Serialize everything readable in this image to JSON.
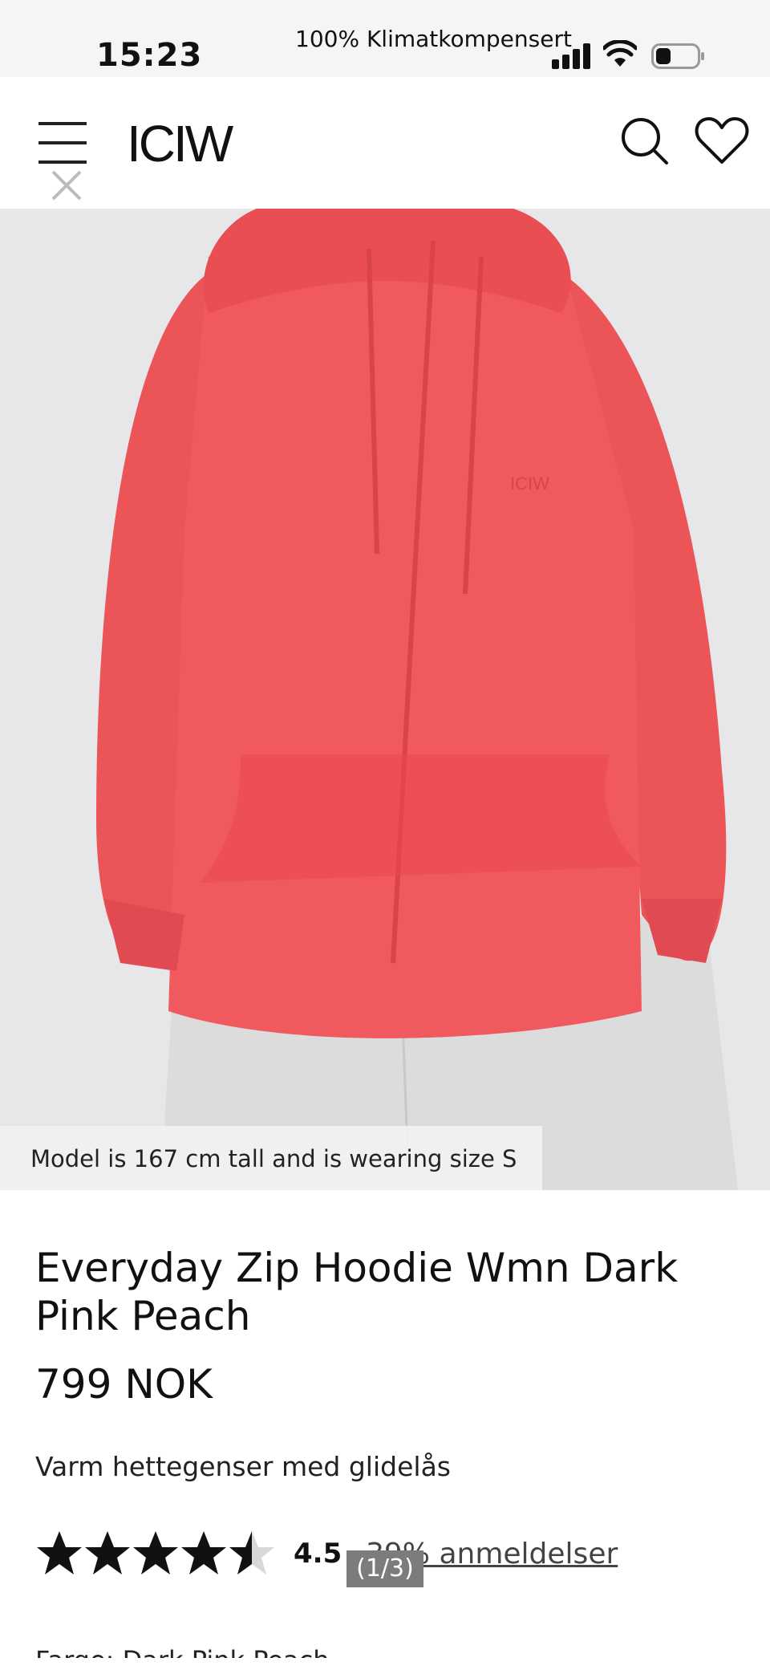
{
  "status_bar": {
    "time": "15:23",
    "carrier": "100% Klimatkompensert"
  },
  "header": {
    "logo": "ICIW",
    "icons": [
      "menu-icon",
      "close-icon",
      "search-icon",
      "heart-icon"
    ]
  },
  "hero": {
    "caption": "Model is 167 cm tall and is wearing size S",
    "image_counter": "(1/3)",
    "colors": {
      "hoodie": "#f05a5e",
      "background": "#e7e7e9",
      "pants": "#dcdcdc"
    }
  },
  "product": {
    "title": "Everyday Zip Hoodie Wmn Dark Pink Peach",
    "price": "799 NOK",
    "description": "Varm hettegenser med glidelås",
    "rating": {
      "value": "4.5",
      "stars": 4.5,
      "reviews_link": "39% anmeldelser"
    },
    "color_label": "Farge: Dark Pink Peach"
  }
}
